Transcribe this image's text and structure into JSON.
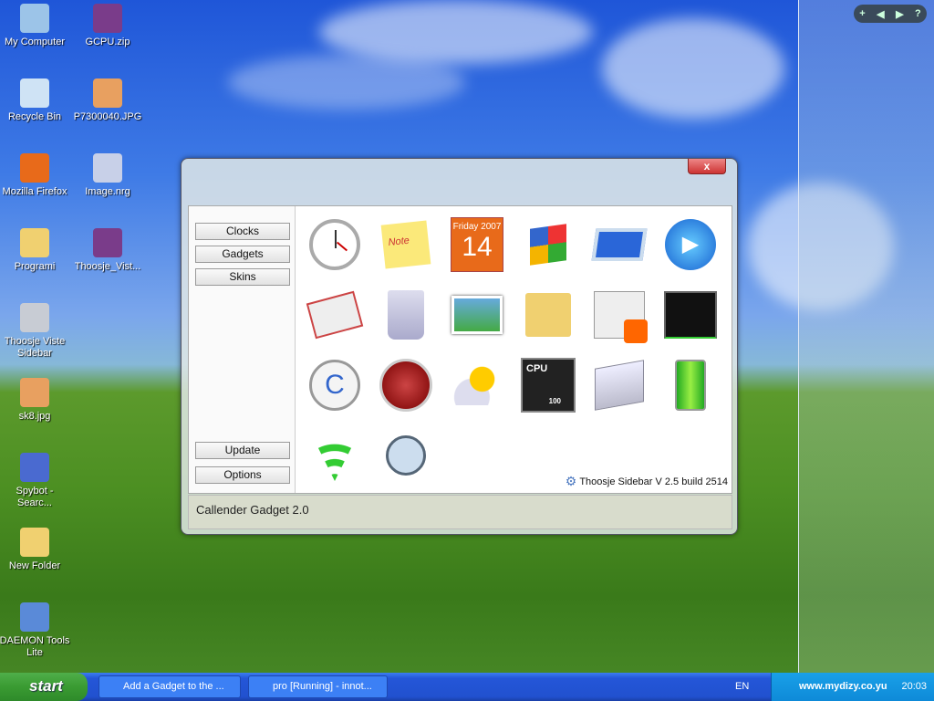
{
  "desktop": {
    "icons": [
      {
        "label": "My Computer",
        "color": "#9cc4e8"
      },
      {
        "label": "GCPU.zip",
        "color": "#7a3c8a"
      },
      {
        "label": "Recycle Bin",
        "color": "#cfe3f5"
      },
      {
        "label": "P7300040.JPG",
        "color": "#e8a060"
      },
      {
        "label": "Mozilla Firefox",
        "color": "#e86a1a"
      },
      {
        "label": "Image.nrg",
        "color": "#c8d0e8"
      },
      {
        "label": "Programi",
        "color": "#f0d070"
      },
      {
        "label": "Thoosje_Vist...",
        "color": "#7a3c8a"
      },
      {
        "label": "Thoosje Viste Sidebar",
        "color": "#c8ccd4"
      },
      {
        "label": "sk8.jpg",
        "color": "#e8a060"
      },
      {
        "label": "Spybot - Searc...",
        "color": "#4a6ad0"
      },
      {
        "label": "New Folder",
        "color": "#f0d070"
      },
      {
        "label": "DAEMON Tools Lite",
        "color": "#5a8ad8"
      }
    ]
  },
  "sidebar_controls": {
    "add": "+",
    "prev": "◀",
    "next": "▶",
    "help": "?"
  },
  "dialog": {
    "close": "x",
    "menu": {
      "clocks": "Clocks",
      "gadgets": "Gadgets",
      "skins": "Skins",
      "update": "Update",
      "options": "Options"
    },
    "gadgets": [
      {
        "name": "clock"
      },
      {
        "name": "notes",
        "text": "Note"
      },
      {
        "name": "calendar",
        "header": "Friday 2007",
        "day": "14"
      },
      {
        "name": "windows"
      },
      {
        "name": "slideshow"
      },
      {
        "name": "media-player"
      },
      {
        "name": "mail"
      },
      {
        "name": "recycle-bin"
      },
      {
        "name": "photos"
      },
      {
        "name": "folder-clock"
      },
      {
        "name": "news-rss"
      },
      {
        "name": "network-monitor"
      },
      {
        "name": "search"
      },
      {
        "name": "search-red"
      },
      {
        "name": "weather"
      },
      {
        "name": "cpu-meter",
        "label": "CPU",
        "value": "100"
      },
      {
        "name": "calculator"
      },
      {
        "name": "battery"
      },
      {
        "name": "wifi"
      },
      {
        "name": "people-search"
      }
    ],
    "version": "Thoosje Sidebar V 2.5  build 2514",
    "status": "Callender Gadget 2.0"
  },
  "taskbar": {
    "start": "start",
    "tasks": [
      "Add a Gadget to the ...",
      "pro [Running] - innot..."
    ],
    "language": "EN",
    "clock": "20:03",
    "watermark": "www.mydizy.co.yu"
  }
}
